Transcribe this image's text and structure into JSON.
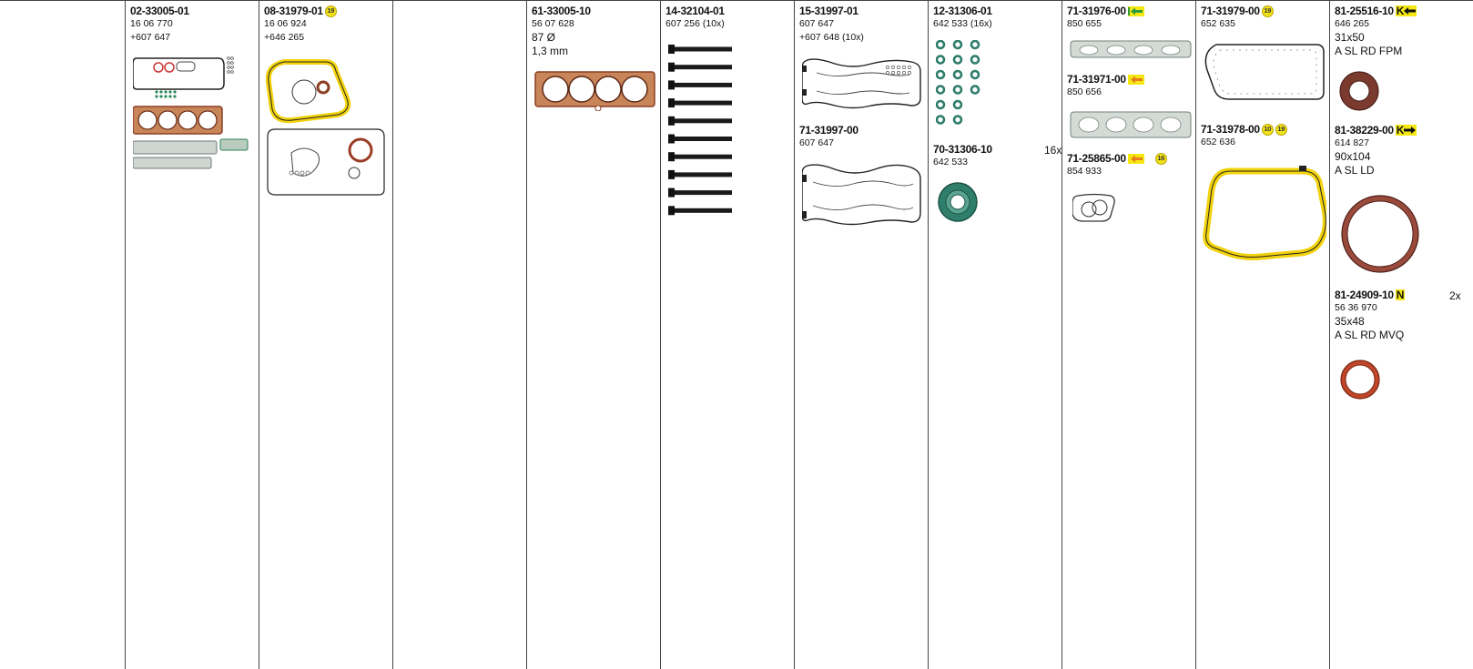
{
  "columns": [
    {
      "id": "c1",
      "entries": []
    },
    {
      "id": "c2",
      "entries": [
        {
          "part_number": "02-33005-01",
          "lines": [
            "16 06 770",
            "+607 647"
          ]
        }
      ]
    },
    {
      "id": "c3",
      "entries": [
        {
          "part_number": "08-31979-01",
          "badge": "19",
          "lines": [
            "16 06 924",
            "+646 265"
          ]
        }
      ]
    },
    {
      "id": "c4",
      "entries": []
    },
    {
      "id": "c5",
      "entries": [
        {
          "part_number": "61-33005-10",
          "lines": [
            "56 07 628",
            "87 Ø",
            "1,3 mm"
          ]
        }
      ]
    },
    {
      "id": "c6",
      "entries": [
        {
          "part_number": "14-32104-01",
          "lines": [
            "607 256 (10x)"
          ]
        }
      ]
    },
    {
      "id": "c7",
      "entries": [
        {
          "part_number": "15-31997-01",
          "lines": [
            "607 647",
            "+607 648 (10x)"
          ]
        },
        {
          "part_number": "71-31997-00",
          "lines": [
            "607 647"
          ]
        }
      ]
    },
    {
      "id": "c8",
      "entries": [
        {
          "part_number": "12-31306-01",
          "lines": [
            "642 533 (16x)"
          ]
        },
        {
          "part_number": "70-31306-10",
          "quantity": "16x",
          "lines": [
            "642 533"
          ]
        }
      ]
    },
    {
      "id": "c9",
      "entries": [
        {
          "part_number": "71-31976-00",
          "lines": [
            "850 655"
          ]
        },
        {
          "part_number": "71-31971-00",
          "lines": [
            "850 656"
          ]
        },
        {
          "part_number": "71-25865-00",
          "badge": "16",
          "lines": [
            "854 933"
          ]
        }
      ]
    },
    {
      "id": "c10",
      "entries": [
        {
          "part_number": "71-31979-00",
          "badge": "19",
          "lines": [
            "652 635"
          ]
        },
        {
          "part_number": "71-31978-00",
          "badges": [
            "10",
            "19"
          ],
          "lines": [
            "652 636"
          ]
        }
      ]
    },
    {
      "id": "c11",
      "entries": [
        {
          "part_number": "81-25516-10",
          "tag": "K",
          "lines": [
            "646 265",
            "31x50",
            "A SL RD FPM"
          ]
        },
        {
          "part_number": "81-38229-00",
          "tag": "K",
          "lines": [
            "614 827",
            "90x104",
            "A SL LD"
          ]
        },
        {
          "part_number": "81-24909-10",
          "tag": "N",
          "quantity": "2x",
          "lines": [
            "56 36 970",
            "35x48",
            "A SL RD MVQ"
          ]
        }
      ]
    }
  ],
  "colors": {
    "highlight_yellow": "#f5e711",
    "arrow_green": "#2e9b3a",
    "gasket_copper": "#a0523d",
    "seal_brown": "#7a3a2e",
    "seal_green": "#2f7d6b",
    "seal_red": "#c0462a",
    "gasket_gray": "#9aa59f"
  },
  "icons": [
    "arrow-left-icon",
    "arrow-right-icon",
    "badge-circle-icon"
  ]
}
